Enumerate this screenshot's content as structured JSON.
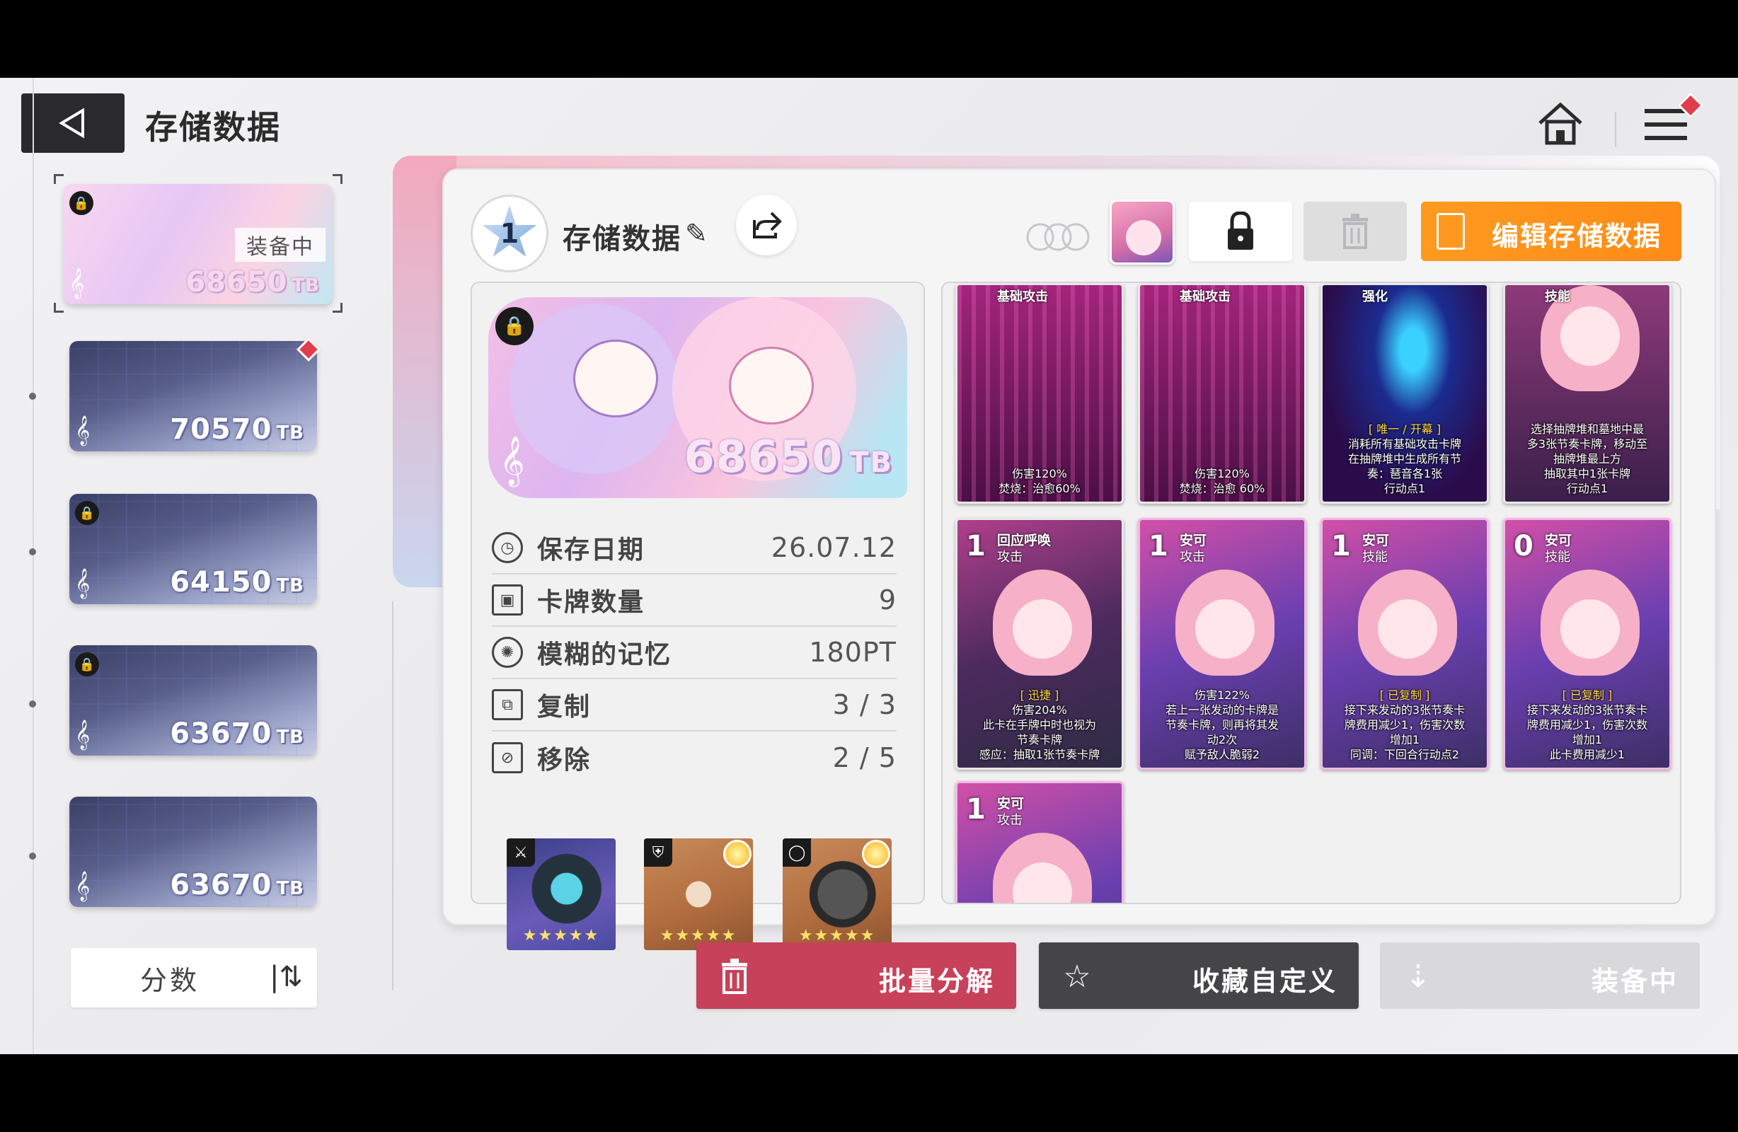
{
  "header": {
    "title": "存储数据",
    "back_icon": "back-arrow-icon",
    "home_icon": "home-icon",
    "menu_icon": "menu-icon"
  },
  "slots": [
    {
      "value": "68650",
      "unit": "TB",
      "status": "装备中",
      "locked": true
    },
    {
      "value": "70570",
      "unit": "TB",
      "locked": false
    },
    {
      "value": "64150",
      "unit": "TB",
      "locked": true
    },
    {
      "value": "63670",
      "unit": "TB",
      "locked": true
    },
    {
      "value": "63670",
      "unit": "TB",
      "locked": false
    }
  ],
  "sort": {
    "label": "分数"
  },
  "deck": {
    "rank": "1",
    "name": "存储数据",
    "cover_value": "68650",
    "cover_unit": "TB"
  },
  "toolbar": {
    "edit_label": "编辑存储数据"
  },
  "stats": [
    {
      "label": "保存日期",
      "value": "26.07.12",
      "icon": "clock-icon"
    },
    {
      "label": "卡牌数量",
      "value": "9",
      "icon": "cards-icon"
    },
    {
      "label": "模糊的记忆",
      "value": "180PT",
      "icon": "brain-icon"
    },
    {
      "label": "复制",
      "value": "3 / 3",
      "icon": "copy-icon"
    },
    {
      "label": "移除",
      "value": "2 / 5",
      "icon": "remove-icon"
    }
  ],
  "gear": [
    {
      "type_icon": "weapon-icon",
      "stars": "★★★★★",
      "sun": false
    },
    {
      "type_icon": "armor-icon",
      "stars": "★★★★★",
      "sun": true
    },
    {
      "type_icon": "ring-icon",
      "stars": "★★★★★",
      "sun": true
    }
  ],
  "cards": [
    {
      "cost": "",
      "name": "",
      "type": "基础攻击",
      "desc": [
        "伤害120%",
        "焚烧：治愈60%"
      ]
    },
    {
      "cost": "",
      "name": "",
      "type": "基础攻击",
      "desc": [
        "伤害120%",
        "焚烧：治愈 60%"
      ]
    },
    {
      "cost": "",
      "name": "",
      "type": "强化",
      "desc": [
        "[ 唯一 / 开幕 ]",
        "消耗所有基础攻击卡牌",
        "在抽牌堆中生成所有节",
        "奏：琶音各1张",
        "行动点1"
      ]
    },
    {
      "cost": "",
      "name": "",
      "type": "技能",
      "desc": [
        "选择抽牌堆和墓地中最",
        "多3张节奏卡牌，移动至",
        "抽牌堆最上方",
        "抽取其中1张卡牌",
        "行动点1"
      ]
    },
    {
      "cost": "1",
      "name": "回应呼唤",
      "type": "攻击",
      "desc": [
        "[ 迅捷 ]",
        "伤害204%",
        "此卡在手牌中时也视为",
        "节奏卡牌",
        "感应：抽取1张节奏卡牌"
      ]
    },
    {
      "cost": "1",
      "name": "安可",
      "type": "攻击",
      "desc": [
        "伤害122%",
        "若上一张发动的卡牌是",
        "节奏卡牌，则再将其发",
        "动2次",
        "赋予敌人脆弱2"
      ]
    },
    {
      "cost": "1",
      "name": "安可",
      "type": "技能",
      "desc": [
        "[ 已复制 ]",
        "接下来发动的3张节奏卡",
        "牌费用减少1，伤害次数",
        "增加1",
        "同调：下回合行动点2"
      ]
    },
    {
      "cost": "0",
      "name": "安可",
      "type": "技能",
      "desc": [
        "[ 已复制 ]",
        "接下来发动的3张节奏卡",
        "牌费用减少1，伤害次数",
        "增加1",
        "此卡费用减少1"
      ]
    },
    {
      "cost": "1",
      "name": "安可",
      "type": "攻击",
      "desc": []
    }
  ],
  "actions": {
    "bulk_label": "批量分解",
    "fav_label": "收藏自定义",
    "equip_label": "装备中"
  },
  "colors": {
    "accent_orange": "#ff9a1f",
    "bulk_red": "#c8415a",
    "dark_button": "#454548",
    "badge_red": "#e23d4d"
  }
}
